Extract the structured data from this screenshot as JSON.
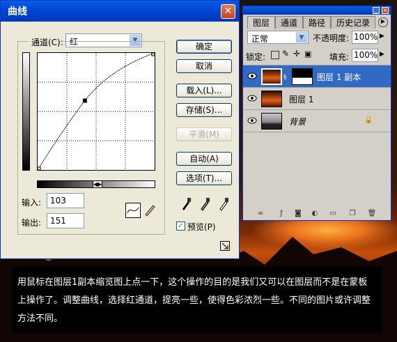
{
  "curves_dialog": {
    "title": "曲线",
    "close_label": "✕",
    "channel_label": "通道(C):",
    "channel_value": "红",
    "buttons": {
      "ok": "确定",
      "cancel": "取消",
      "load": "载入(L)...",
      "save": "存储(S)...",
      "smooth": "平滑(M)",
      "auto": "自动(A)",
      "options": "选项(T)..."
    },
    "input_label": "输入:",
    "input_value": "103",
    "output_label": "输出:",
    "output_value": "151",
    "preview_label": "预览(P)",
    "preview_checked": true,
    "curve_point": {
      "input": 103,
      "output": 151
    }
  },
  "layers_panel": {
    "tabs": [
      "图层",
      "通道",
      "路径",
      "历史记录"
    ],
    "blend_mode": "正常",
    "opacity_label": "不透明度:",
    "opacity_value": "100%",
    "lock_label": "锁定:",
    "fill_label": "填充:",
    "fill_value": "100%",
    "layers": [
      {
        "name": "图层 1 副本",
        "selected": true
      },
      {
        "name": "图层 1",
        "selected": false
      },
      {
        "name": "背景",
        "selected": false,
        "locked": true
      }
    ]
  },
  "caption": "用鼠标在图层1副本缩览图上点一下，这个操作的目的是我们又可以在图层而不是在蒙板上操作了。调整曲线，选择红通道，提亮一些，使得色彩浓烈一些。不同的图片或许调整方法不同。"
}
